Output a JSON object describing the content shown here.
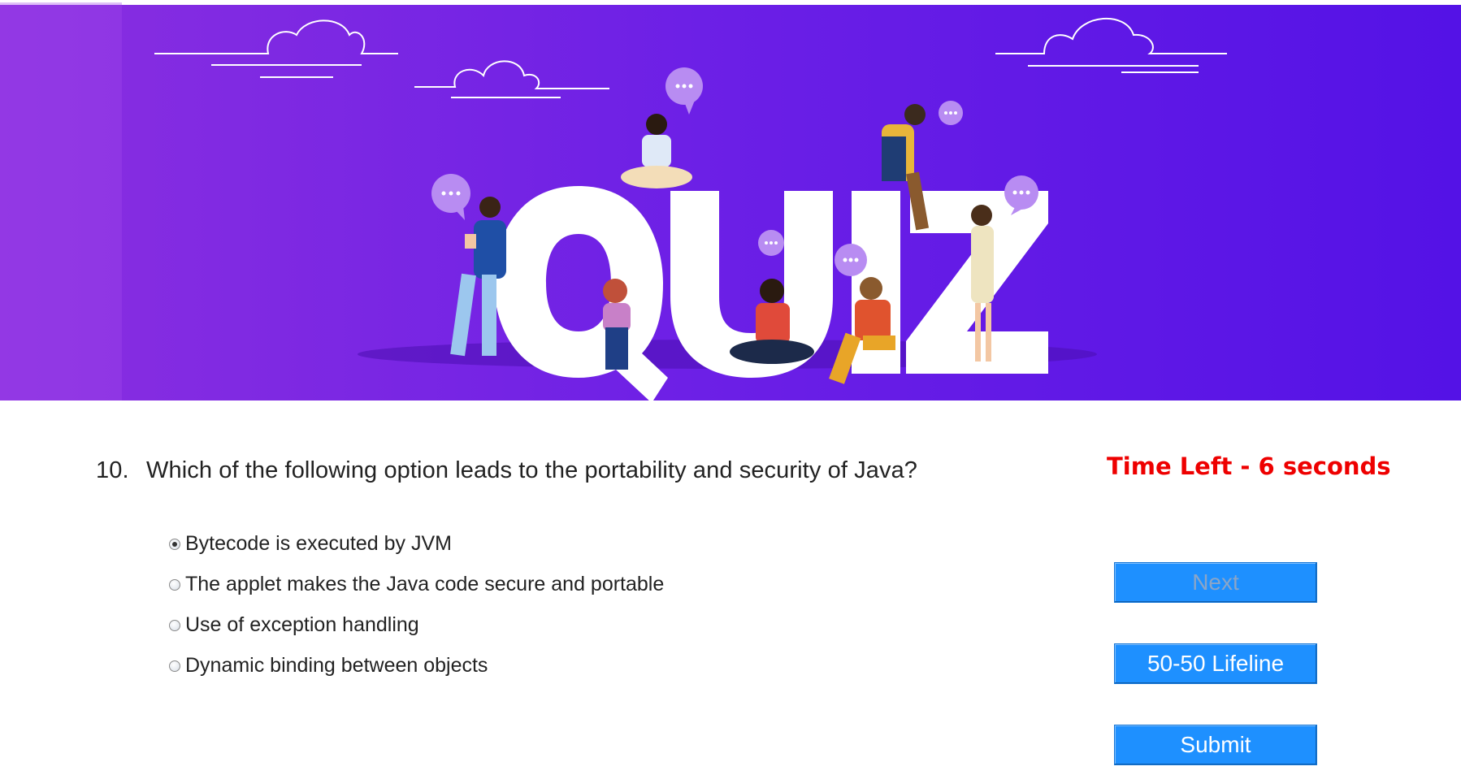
{
  "banner": {
    "logo_text": "QUIZ",
    "colors": {
      "gradient_left": "#8a2fe0",
      "gradient_right": "#5412e6"
    }
  },
  "question": {
    "number": "10.",
    "text": "Which of the following option leads to the portability and security of Java?"
  },
  "timer": {
    "text": "Time Left - 6 seconds",
    "color": "#ee0000"
  },
  "options": [
    {
      "label": "Bytecode is executed by JVM",
      "selected": true
    },
    {
      "label": "The applet makes the Java code secure and portable",
      "selected": false
    },
    {
      "label": "Use of exception handling",
      "selected": false
    },
    {
      "label": "Dynamic binding between objects",
      "selected": false
    }
  ],
  "buttons": {
    "next": {
      "label": "Next",
      "enabled": false
    },
    "lifeline": {
      "label": "50-50 Lifeline",
      "enabled": true
    },
    "submit": {
      "label": "Submit",
      "enabled": true
    }
  },
  "accent_color": "#1e90ff"
}
